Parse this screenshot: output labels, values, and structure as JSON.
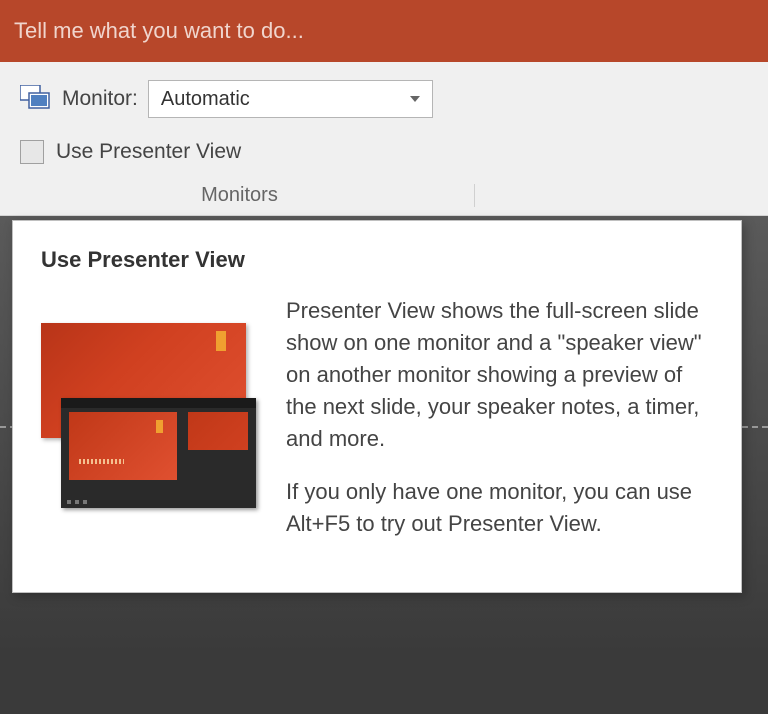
{
  "tellme": {
    "placeholder": "Tell me what you want to do..."
  },
  "ribbon": {
    "monitor_label": "Monitor:",
    "monitor_value": "Automatic",
    "presenter_check_label": "Use Presenter View",
    "group_label": "Monitors"
  },
  "tooltip": {
    "title": "Use Presenter View",
    "para1": "Presenter View shows the full-screen slide show on one monitor and a \"speaker view\" on another monitor showing a preview of the next slide, your speaker notes, a timer, and more.",
    "para2": "If you only have one monitor, you can use Alt+F5 to try out Presenter View."
  },
  "icons": {
    "monitors": "monitors-icon",
    "chevron_down": "chevron-down-icon"
  }
}
